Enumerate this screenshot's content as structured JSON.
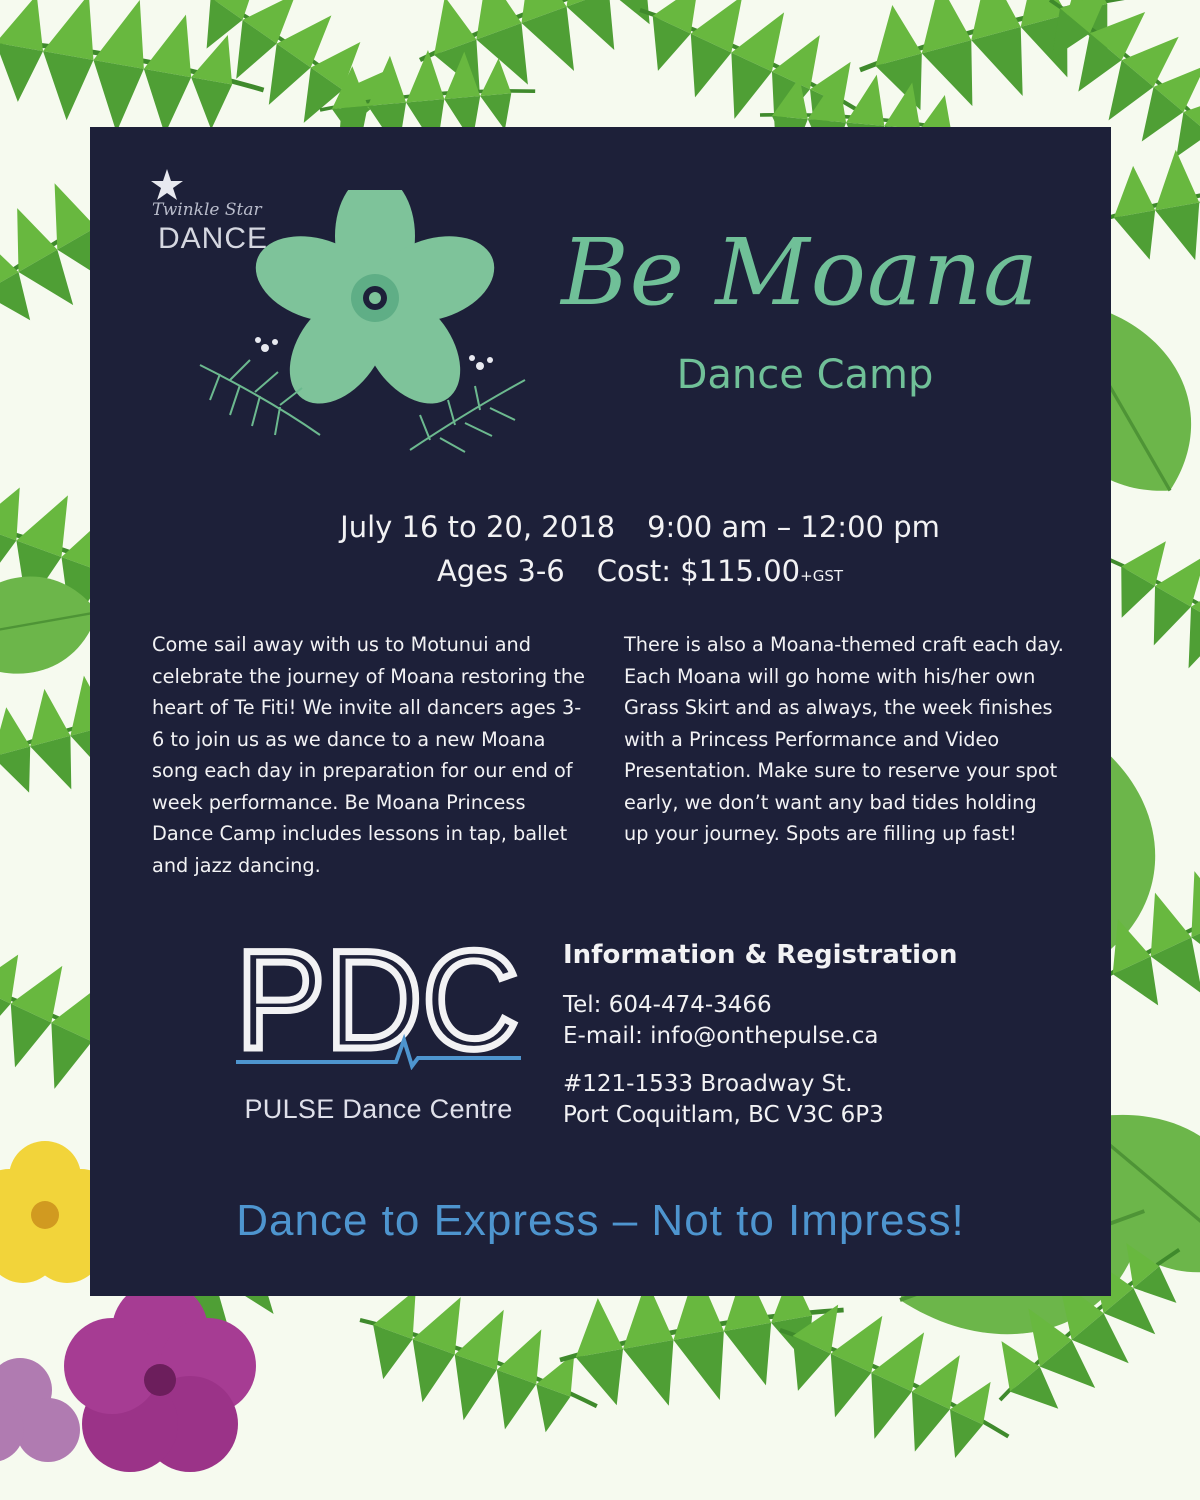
{
  "brand": {
    "twinkle_script": "Twinkle Star",
    "twinkle_dance": "DANCE"
  },
  "title": "Be Moana",
  "subtitle": "Dance Camp",
  "details": {
    "dates": "July 16 to 20, 2018",
    "time": "9:00 am – 12:00 pm",
    "ages": "Ages 3-6",
    "cost": "Cost: $115.00",
    "cost_suffix": "+GST"
  },
  "description_left": "Come sail away with us to Motunui and celebrate the journey of Moana restoring the heart of Te Fiti! We invite all dancers ages 3-6 to join us as we dance to a new Moana song each day in preparation for our end of week performance. Be Moana Princess Dance Camp includes lessons in tap, ballet and jazz dancing.",
  "description_right": "There is also a Moana-themed craft each day. Each Moana will go home with his/her own Grass Skirt and as always, the week finishes with a Princess Performance and Video Presentation. Make sure to reserve your spot early, we don’t want any bad tides holding up your journey. Spots are filling up fast!",
  "pdc": {
    "logo_text": "PDC",
    "subtitle": "PULSE Dance Centre"
  },
  "info": {
    "heading": "Information & Registration",
    "tel": "Tel: 604-474-3466",
    "email": "E-mail: info@onthepulse.ca",
    "address1": "#121-1533 Broadway St.",
    "address2": "Port Coquitlam, BC   V3C 6P3"
  },
  "tagline": "Dance to Express – Not to Impress!",
  "colors": {
    "panel": "#1d2039",
    "accent_green": "#70c098",
    "tagline_blue": "#4e95cf",
    "leaf_green": "#5fae3c"
  },
  "icons": [
    "star-icon",
    "hibiscus-flower-icon",
    "palm-leaf-icon",
    "ecg-pulse-icon"
  ]
}
